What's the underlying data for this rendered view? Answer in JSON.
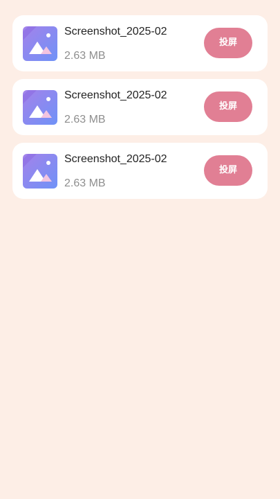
{
  "files": [
    {
      "name": "Screenshot_2025-02",
      "size": "2.63 MB",
      "cast_label": "投屏",
      "icon": "image-icon"
    },
    {
      "name": "Screenshot_2025-02",
      "size": "2.63 MB",
      "cast_label": "投屏",
      "icon": "image-icon"
    },
    {
      "name": "Screenshot_2025-02",
      "size": "2.63 MB",
      "cast_label": "投屏",
      "icon": "image-icon"
    }
  ],
  "colors": {
    "background": "#fdeee6",
    "card": "#ffffff",
    "button": "#e17f94",
    "icon_top": "#9b86ec",
    "icon_bottom": "#7c8cf5"
  }
}
